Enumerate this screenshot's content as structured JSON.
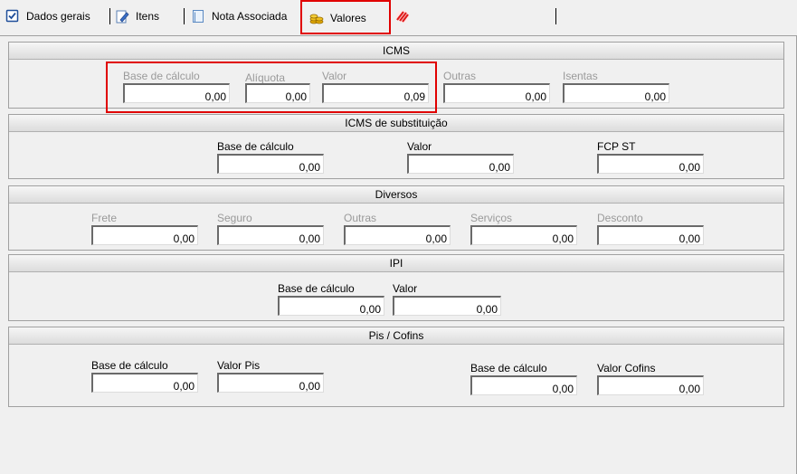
{
  "tabs": [
    {
      "label": "Dados gerais"
    },
    {
      "label": "Itens"
    },
    {
      "label": "Nota Associada"
    },
    {
      "label": "Valores"
    }
  ],
  "icms": {
    "title": "ICMS",
    "fields": [
      {
        "label": "Base de cálculo",
        "value": "0,00"
      },
      {
        "label": "Alíquota",
        "value": "0,00"
      },
      {
        "label": "Valor",
        "value": "0,09"
      },
      {
        "label": "Outras",
        "value": "0,00"
      },
      {
        "label": "Isentas",
        "value": "0,00"
      }
    ]
  },
  "icms_st": {
    "title": "ICMS de substituição",
    "fields": [
      {
        "label": "Base de cálculo",
        "value": "0,00"
      },
      {
        "label": "Valor",
        "value": "0,00"
      },
      {
        "label": "FCP ST",
        "value": "0,00"
      }
    ]
  },
  "diversos": {
    "title": "Diversos",
    "fields": [
      {
        "label": "Frete",
        "value": "0,00"
      },
      {
        "label": "Seguro",
        "value": "0,00"
      },
      {
        "label": "Outras",
        "value": "0,00"
      },
      {
        "label": "Serviços",
        "value": "0,00"
      },
      {
        "label": "Desconto",
        "value": "0,00"
      }
    ]
  },
  "ipi": {
    "title": "IPI",
    "fields": [
      {
        "label": "Base de cálculo",
        "value": "0,00"
      },
      {
        "label": "Valor",
        "value": "0,00"
      }
    ]
  },
  "pis_cofins": {
    "title": "Pis / Cofins",
    "fields": [
      {
        "label": "Base de cálculo",
        "value": "0,00"
      },
      {
        "label": "Valor Pis",
        "value": "0,00"
      },
      {
        "label": "Base de cálculo",
        "value": "0,00"
      },
      {
        "label": "Valor Cofins",
        "value": "0,00"
      }
    ]
  }
}
